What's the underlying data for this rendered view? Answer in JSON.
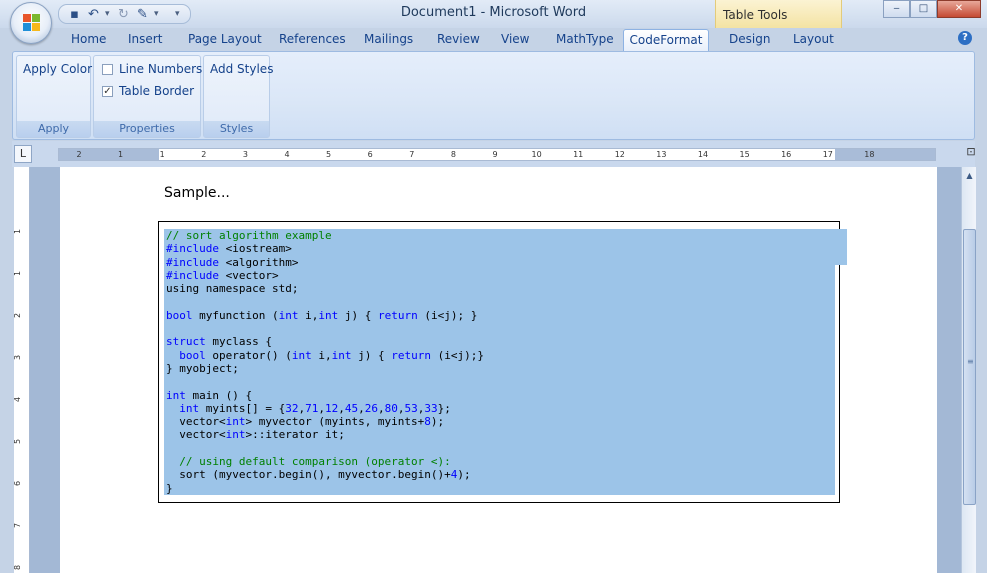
{
  "window": {
    "title": "Document1 - Microsoft Word",
    "context_tab_group": "Table Tools",
    "minimize_glyph": "‒",
    "maximize_glyph": "□",
    "close_glyph": "✕"
  },
  "quick_access": {
    "icons": [
      "save-icon",
      "undo-icon",
      "redo-icon",
      "format-painter-icon",
      "customize-icon"
    ]
  },
  "tabs": {
    "home": "Home",
    "insert": "Insert",
    "page_layout": "Page Layout",
    "references": "References",
    "mailings": "Mailings",
    "review": "Review",
    "view": "View",
    "mathtype": "MathType",
    "codeformat": "CodeFormat",
    "design": "Design",
    "layout": "Layout",
    "active": "CodeFormat",
    "help": "?"
  },
  "ribbon": {
    "apply_color": "Apply Color",
    "apply_group": "Apply",
    "line_numbers": "Line Numbers",
    "line_numbers_checked": false,
    "table_border": "Table Border",
    "table_border_checked": true,
    "check_mark": "✓",
    "properties_group": "Properties",
    "add_styles": "Add Styles",
    "styles_group": "Styles"
  },
  "ruler": {
    "labels": [
      "2",
      "1",
      "1",
      "2",
      "3",
      "4",
      "5",
      "6",
      "7",
      "8",
      "9",
      "10",
      "11",
      "12",
      "13",
      "14",
      "15",
      "16",
      "17",
      "18"
    ],
    "vertical_labels": [
      "1",
      "1",
      "2",
      "3",
      "4",
      "5",
      "6",
      "7",
      "8"
    ]
  },
  "document": {
    "sample_text": "Sample...",
    "code_lines": [
      "// sort algorithm example",
      "#include <iostream>",
      "#include <algorithm>",
      "#include <vector>",
      "using namespace std;",
      "",
      "bool myfunction (int i,int j) { return (i<j); }",
      "",
      "struct myclass {",
      "  bool operator() (int i,int j) { return (i<j);}",
      "} myobject;",
      "",
      "int main () {",
      "  int myints[] = {32,71,12,45,26,80,53,33};",
      "  vector<int> myvector (myints, myints+8);",
      "  vector<int>::iterator it;",
      "",
      "  // using default comparison (operator <):",
      "  sort (myvector.begin(), myvector.begin()+4);",
      "}"
    ]
  },
  "colors": {
    "comment": "#008000",
    "keyword": "#0000ff",
    "selection": "#9cc4e8"
  }
}
